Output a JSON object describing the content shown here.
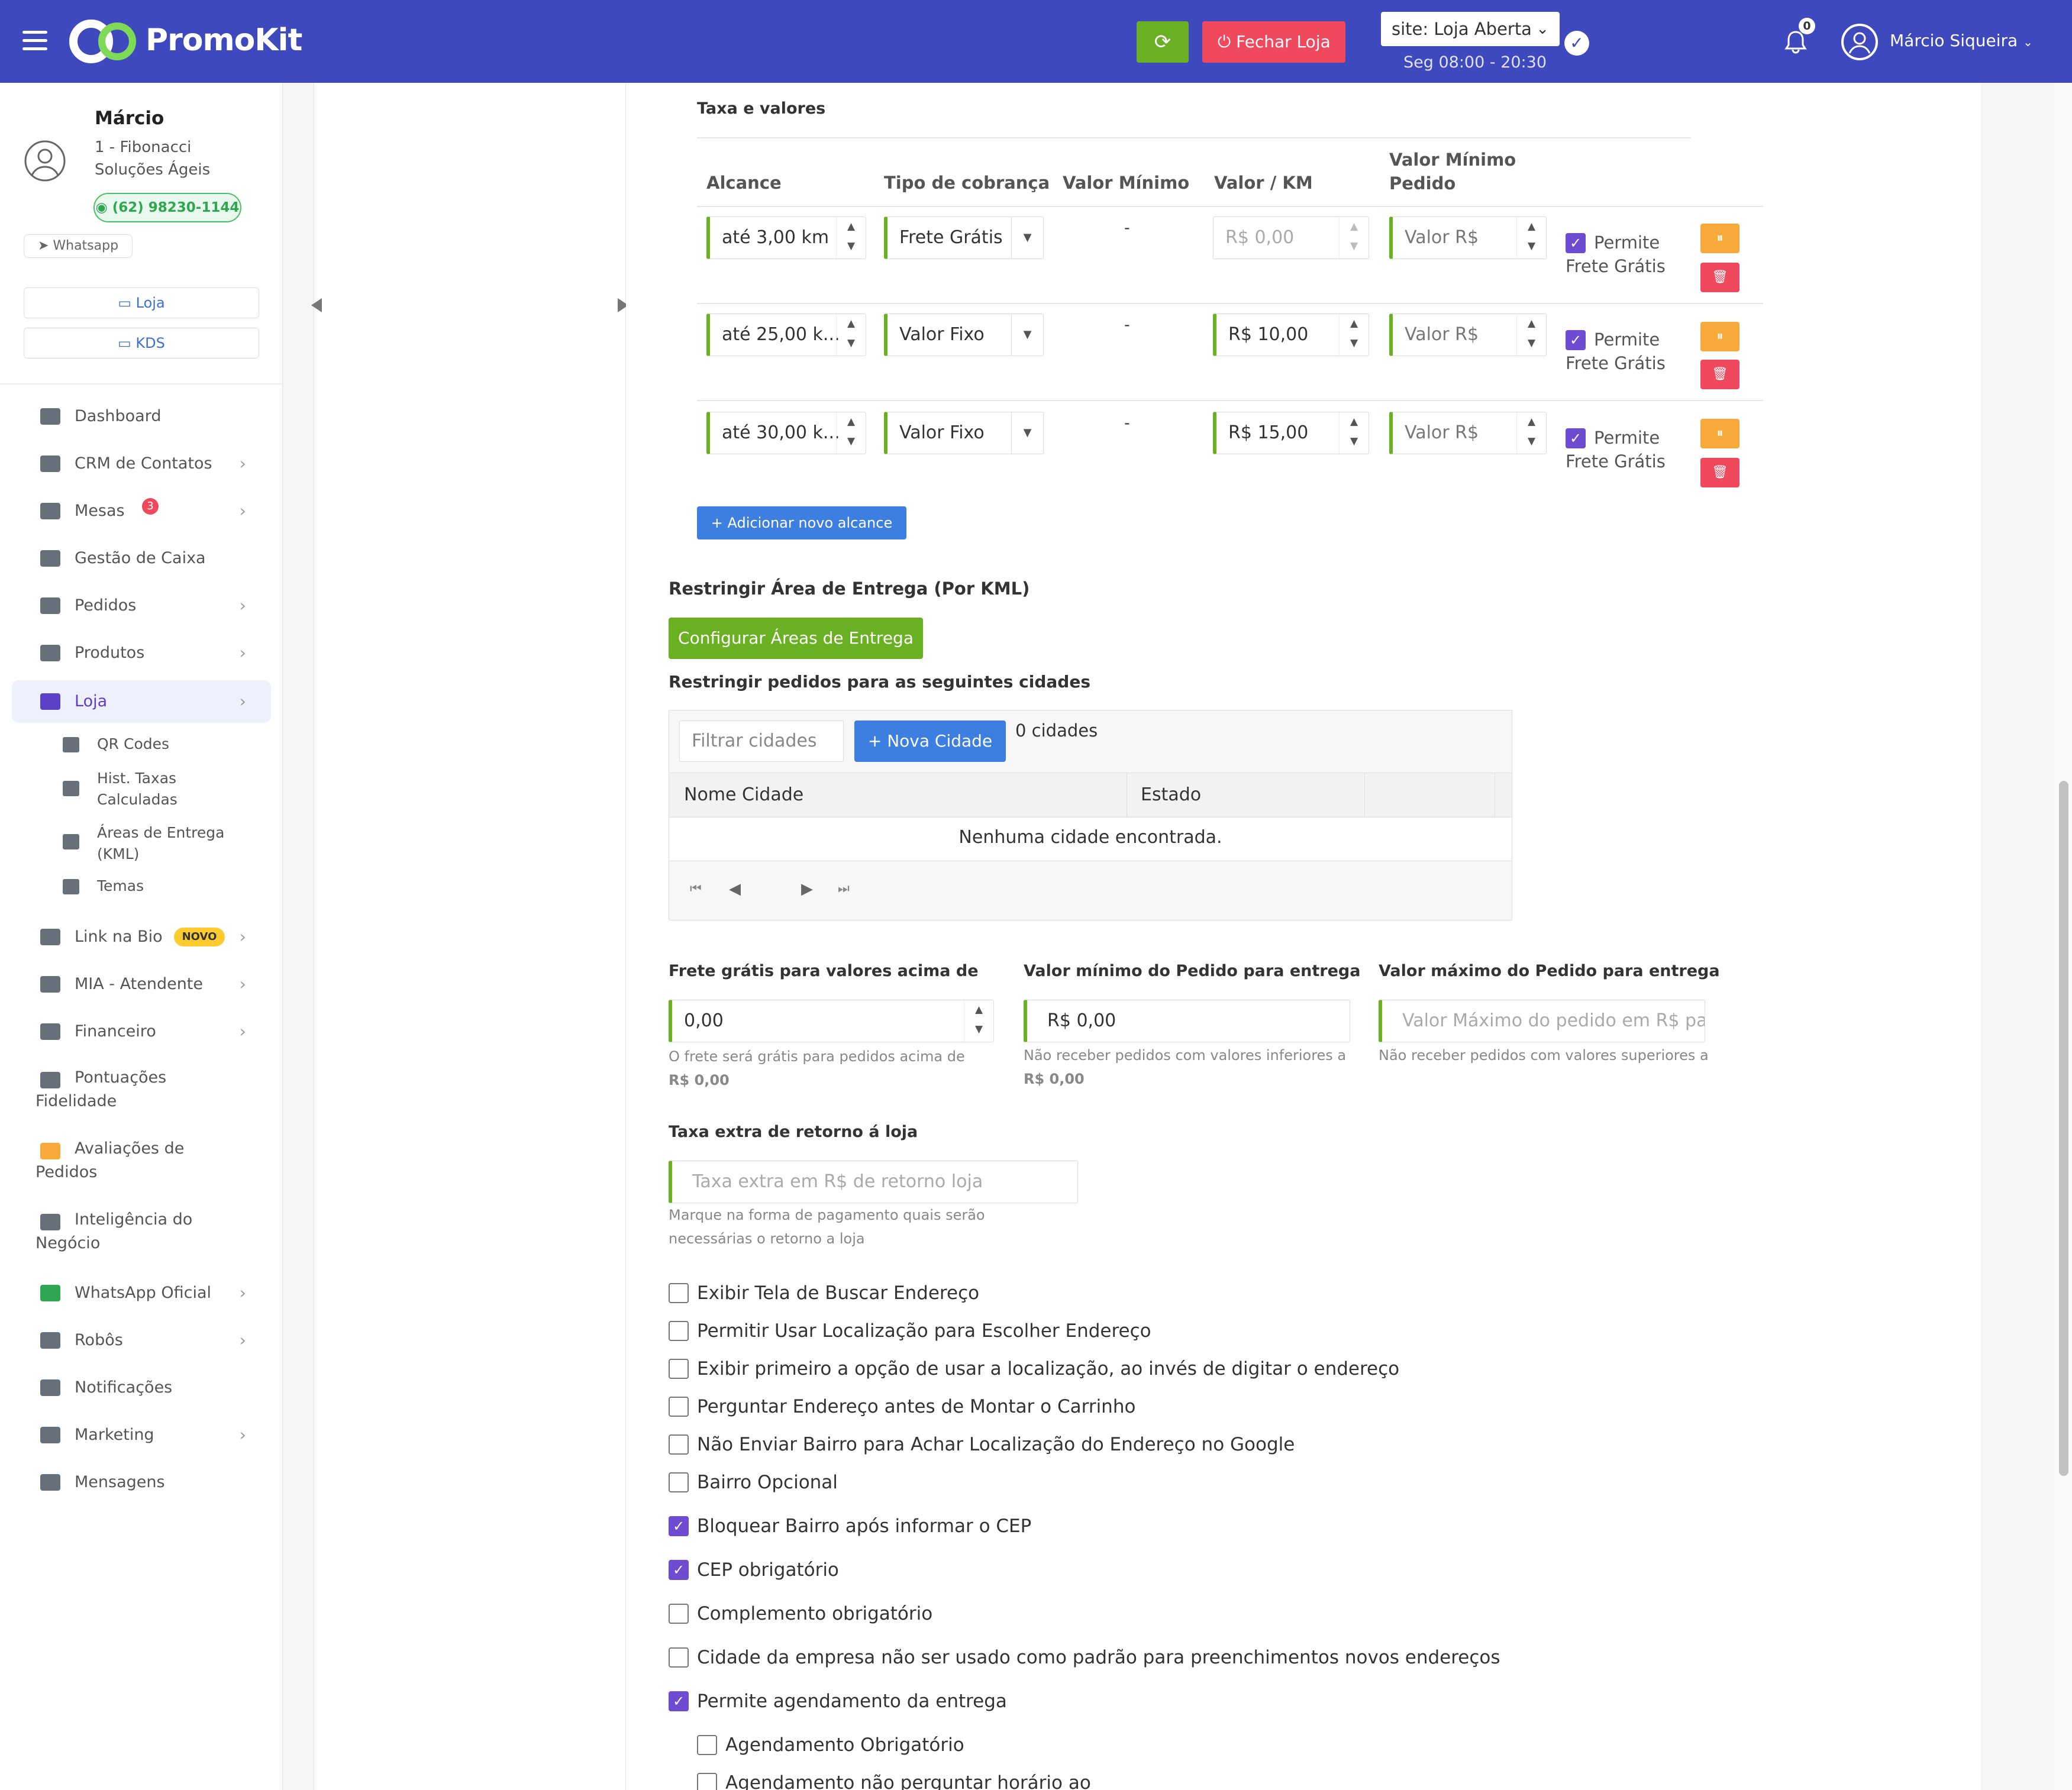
{
  "header": {
    "brand": "PromoKit",
    "close_store_label": "Fechar Loja",
    "site_status": "site: Loja Aberta",
    "hours": "Seg 08:00 - 20:30",
    "notifications_count": "0",
    "user_name": "Márcio Siqueira"
  },
  "profile": {
    "name": "Márcio",
    "company": "1 - Fibonacci Soluções Ágeis",
    "phone": "(62) 98230-1144",
    "whatsapp_label": "Whatsapp",
    "store_button": "Loja",
    "kds_button": "KDS"
  },
  "nav": {
    "dashboard": "Dashboard",
    "crm": "CRM de Contatos",
    "mesas": "Mesas",
    "mesas_badge": "3",
    "caixa": "Gestão de Caixa",
    "pedidos": "Pedidos",
    "produtos": "Produtos",
    "loja": "Loja",
    "qr": "QR Codes",
    "hist": "Hist. Taxas Calculadas",
    "areas": "Áreas de Entrega (KML)",
    "temas": "Temas",
    "linkbio": "Link na Bio",
    "novo_badge": "NOVO",
    "mia": "MIA - Atendente",
    "financeiro": "Financeiro",
    "pontuacoes": "Pontuações Fidelidade",
    "avaliacoes": "Avaliações de Pedidos",
    "inteligencia": "Inteligência do Negócio",
    "whatsapp_oficial": "WhatsApp Oficial",
    "robos": "Robôs",
    "notificacoes": "Notificações",
    "marketing": "Marketing",
    "mensagens": "Mensagens"
  },
  "fees": {
    "section_title": "Taxa e valores",
    "col_alcance": "Alcance",
    "col_tipo": "Tipo de cobrança",
    "col_minimo": "Valor Mínimo",
    "col_km": "Valor / KM",
    "col_min_pedido": "Valor Mínimo Pedido",
    "rows": [
      {
        "alcance": "até 3,00 km",
        "tipo": "Frete Grátis",
        "minimo": "-",
        "km_placeholder": "R$ 0,00",
        "km": "",
        "pedido_placeholder": "Valor R$",
        "permite": "Permite Frete Grátis"
      },
      {
        "alcance": "até 25,00 k...",
        "tipo": "Valor Fixo",
        "minimo": "-",
        "km_placeholder": "",
        "km": "R$ 10,00",
        "pedido_placeholder": "Valor R$",
        "permite": "Permite Frete Grátis"
      },
      {
        "alcance": "até 30,00 k...",
        "tipo": "Valor Fixo",
        "minimo": "-",
        "km_placeholder": "",
        "km": "R$ 15,00",
        "pedido_placeholder": "Valor R$",
        "permite": "Permite Frete Grátis"
      }
    ],
    "add_button": "+ Adicionar novo alcance"
  },
  "kml": {
    "title": "Restringir Área de Entrega (Por KML)",
    "button": "Configurar Áreas de Entrega"
  },
  "cities": {
    "title": "Restringir pedidos para as seguintes cidades",
    "filter_placeholder": "Filtrar cidades",
    "new_button": "+ Nova Cidade",
    "count": "0 cidades",
    "col_name": "Nome Cidade",
    "col_state": "Estado",
    "empty": "Nenhuma cidade encontrada."
  },
  "limits": {
    "free_label": "Frete grátis para valores acima de",
    "free_value": "0,00",
    "free_help": "O frete será grátis para pedidos acima de",
    "free_help_value": "R$ 0,00",
    "min_label": "Valor mínimo do Pedido para entrega",
    "min_value": "R$ 0,00",
    "min_help": "Não receber pedidos com valores inferiores a",
    "min_help_value": "R$ 0,00",
    "max_label": "Valor máximo do Pedido para entrega",
    "max_placeholder": "Valor Máximo do pedido em R$ para",
    "max_help": "Não receber pedidos com valores superiores a"
  },
  "return_fee": {
    "label": "Taxa extra de retorno á loja",
    "placeholder": "Taxa extra em R$ de retorno loja",
    "help": "Marque na forma de pagamento quais serão necessárias o retorno a loja"
  },
  "options": [
    {
      "label": "Exibir Tela de Buscar Endereço",
      "checked": false
    },
    {
      "label": "Permitir Usar Localização para Escolher Endereço",
      "checked": false
    },
    {
      "label": "Exibir primeiro a opção de usar a localização, ao invés de digitar o endereço",
      "checked": false
    },
    {
      "label": "Perguntar Endereço antes de Montar o Carrinho",
      "checked": false
    },
    {
      "label": "Não Enviar Bairro para Achar Localização do Endereço no Google",
      "checked": false
    },
    {
      "label": "Bairro Opcional",
      "checked": false
    },
    {
      "label": "Bloquear Bairro após informar o CEP",
      "checked": true
    },
    {
      "label": "CEP obrigatório",
      "checked": true
    },
    {
      "label": "Complemento obrigatório",
      "checked": false
    },
    {
      "label": "Cidade da empresa não ser usado como padrão para preenchimentos novos endereços",
      "checked": false
    },
    {
      "label": "Permite agendamento da entrega",
      "checked": true
    },
    {
      "label": "Agendamento Obrigatório",
      "checked": false
    },
    {
      "label": "Agendamento não perguntar horário ao",
      "checked": false
    }
  ],
  "colors": {
    "topbar": "#3f49be",
    "accent_green": "#6ab023",
    "danger": "#f0485c",
    "purple": "#6f4bd2",
    "blue": "#3d7fe0",
    "orange": "#f7a93a"
  }
}
